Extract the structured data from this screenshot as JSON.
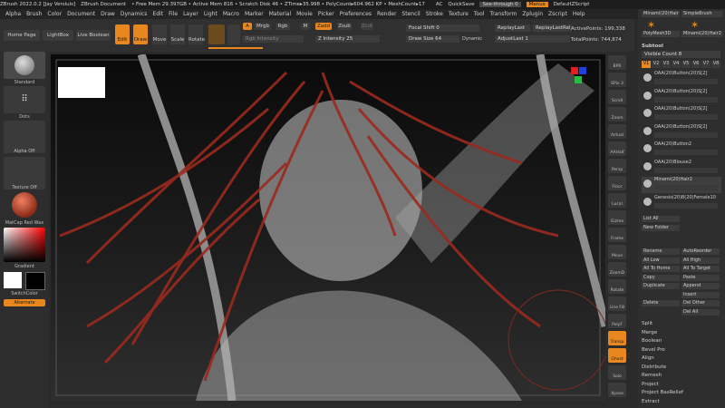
{
  "titlebar": {
    "app": "ZBrush 2022.0.2 [Jay Versluis]",
    "doc": "ZBrush Document",
    "stats": "• Free Mem 29.397GB • Active Mem 816 • Scratch Disk 46 • ZTime▸35.998 • PolyCount▸604.962 KP • MeshCount▸17",
    "ac": "AC",
    "quicksave": "QuickSave",
    "seethrough": "See-through 0",
    "menus": "Menus",
    "script": "DefaultZScript"
  },
  "menubar": [
    "Alpha",
    "Brush",
    "Color",
    "Document",
    "Draw",
    "Dynamics",
    "Edit",
    "File",
    "Layer",
    "Light",
    "Macro",
    "Marker",
    "Material",
    "Movie",
    "Picker",
    "Preferences",
    "Render",
    "Stencil",
    "Stroke",
    "Texture",
    "Tool",
    "Transform",
    "Zplugin",
    "Zscript",
    "Help"
  ],
  "toolbar": {
    "home": "Home Page",
    "lightbox": "LightBox",
    "liveboolean": "Live Boolean",
    "edit": "Edit",
    "draw": "Draw",
    "move": "Move",
    "scale": "Scale",
    "rotate": "Rotate",
    "a": "A",
    "mrgb": "Mrgb",
    "rgb": "Rgb",
    "m": "M",
    "zadd": "Zadd",
    "zsub": "Zsub",
    "zcut": "Zcut",
    "rgb_intensity": "Rgb Intensity",
    "z_intensity": "Z Intensity 25",
    "focal_shift": "Focal Shift 0",
    "draw_size": "Draw Size 64",
    "dynamic": "Dynamic",
    "replaylast": "ReplayLast",
    "replaylastrel": "ReplayLastRel",
    "adjustlast": "AdjustLast 1",
    "active_points": "ActivePoints: 199,338",
    "total_points": "TotalPoints: 744,874"
  },
  "leftshelf": {
    "standard": "Standard",
    "dots": "Dots",
    "alpha": "Alpha Off",
    "texture": "Texture Off",
    "matcap": "MatCap Red Wax",
    "gradient": "Gradient",
    "switchcolor": "SwitchColor",
    "alternate": "Alternate"
  },
  "rightshelf": [
    "BPR",
    "SPix 3",
    "Scroll",
    "Zoom",
    "Actual",
    "AAHalf",
    "Persp",
    "Floor",
    "Local",
    "Gizmo",
    "Frame",
    "Move",
    "ZoomD",
    "Rotate",
    "Line Fill",
    "PolyF",
    "Transp",
    "Ghost",
    "Solo",
    "Xpose"
  ],
  "toolpanel": {
    "top": [
      "Minami(20)Hair",
      "SimpleBrush",
      "PolyMesh3D",
      "Minami(20)Hair2"
    ],
    "subtool_title": "Subtool",
    "visible_count": "Visible Count 8",
    "versions": [
      "V1",
      "V2",
      "V3",
      "V4",
      "V5",
      "V6",
      "V7",
      "V8"
    ],
    "subtools": [
      "OAA(20)Button(20)S[2]",
      "OAA(20)Button(20)S[2]",
      "OAA(20)Button(20)S[2]",
      "OAA(20)Button(20)S[2]",
      "OAA(20)Button2",
      "OAA(20)Blouse2",
      "Minami(20)Hair2",
      "Genesis(20)8(20)Female10"
    ],
    "list_all": "List All",
    "new_folder": "New Folder",
    "buttons": [
      [
        "Rename",
        "AutoReorder"
      ],
      [
        "All Low",
        "All High"
      ],
      [
        "All To Home",
        "All To Target"
      ],
      [
        "Copy",
        "Paste"
      ],
      [
        "Duplicate",
        "Append"
      ],
      [
        "",
        "Insert"
      ],
      [
        "Delete",
        "Del Other"
      ],
      [
        "",
        "Del All"
      ]
    ],
    "sections": [
      "Split",
      "Merge",
      "Boolean",
      "Bevel Pro",
      "Align",
      "Distribute",
      "Remesh",
      "Project",
      "Project BasRelief",
      "Extract"
    ]
  },
  "colors": {
    "accent": "#e8871e",
    "hair": "#9b2a1d"
  }
}
